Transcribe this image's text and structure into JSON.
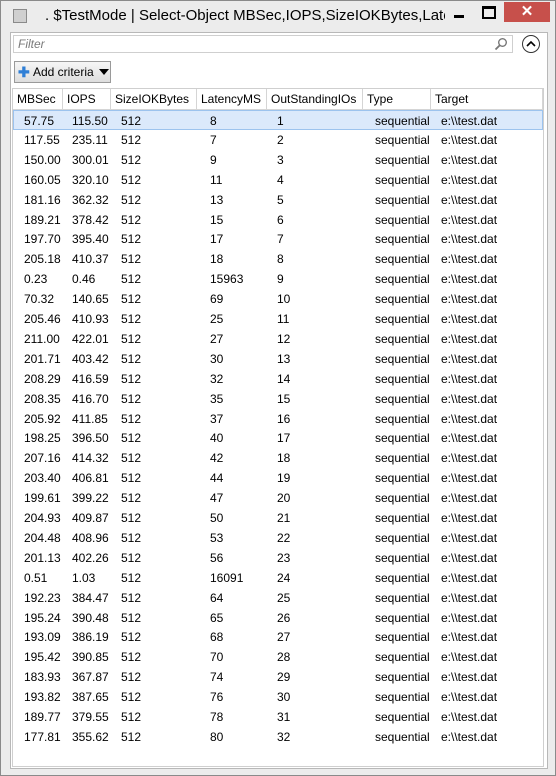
{
  "window": {
    "title": ". $TestMode | Select-Object MBSec,IOPS,SizeIOKBytes,Late...",
    "minimize_label": "",
    "maximize_label": "",
    "close_label": "✕"
  },
  "filter": {
    "placeholder": "Filter"
  },
  "toolbar": {
    "add_criteria_label": "Add criteria"
  },
  "grid": {
    "columns": [
      "MBSec",
      "IOPS",
      "SizeIOKBytes",
      "LatencyMS",
      "OutStandingIOs",
      "Type",
      "Target"
    ],
    "rows": [
      [
        "57.75",
        "115.50",
        "512",
        "8",
        "1",
        "sequential",
        "e:\\\\test.dat"
      ],
      [
        "117.55",
        "235.11",
        "512",
        "7",
        "2",
        "sequential",
        "e:\\\\test.dat"
      ],
      [
        "150.00",
        "300.01",
        "512",
        "9",
        "3",
        "sequential",
        "e:\\\\test.dat"
      ],
      [
        "160.05",
        "320.10",
        "512",
        "11",
        "4",
        "sequential",
        "e:\\\\test.dat"
      ],
      [
        "181.16",
        "362.32",
        "512",
        "13",
        "5",
        "sequential",
        "e:\\\\test.dat"
      ],
      [
        "189.21",
        "378.42",
        "512",
        "15",
        "6",
        "sequential",
        "e:\\\\test.dat"
      ],
      [
        "197.70",
        "395.40",
        "512",
        "17",
        "7",
        "sequential",
        "e:\\\\test.dat"
      ],
      [
        "205.18",
        "410.37",
        "512",
        "18",
        "8",
        "sequential",
        "e:\\\\test.dat"
      ],
      [
        "0.23",
        "0.46",
        "512",
        "15963",
        "9",
        "sequential",
        "e:\\\\test.dat"
      ],
      [
        "70.32",
        "140.65",
        "512",
        "69",
        "10",
        "sequential",
        "e:\\\\test.dat"
      ],
      [
        "205.46",
        "410.93",
        "512",
        "25",
        "11",
        "sequential",
        "e:\\\\test.dat"
      ],
      [
        "211.00",
        "422.01",
        "512",
        "27",
        "12",
        "sequential",
        "e:\\\\test.dat"
      ],
      [
        "201.71",
        "403.42",
        "512",
        "30",
        "13",
        "sequential",
        "e:\\\\test.dat"
      ],
      [
        "208.29",
        "416.59",
        "512",
        "32",
        "14",
        "sequential",
        "e:\\\\test.dat"
      ],
      [
        "208.35",
        "416.70",
        "512",
        "35",
        "15",
        "sequential",
        "e:\\\\test.dat"
      ],
      [
        "205.92",
        "411.85",
        "512",
        "37",
        "16",
        "sequential",
        "e:\\\\test.dat"
      ],
      [
        "198.25",
        "396.50",
        "512",
        "40",
        "17",
        "sequential",
        "e:\\\\test.dat"
      ],
      [
        "207.16",
        "414.32",
        "512",
        "42",
        "18",
        "sequential",
        "e:\\\\test.dat"
      ],
      [
        "203.40",
        "406.81",
        "512",
        "44",
        "19",
        "sequential",
        "e:\\\\test.dat"
      ],
      [
        "199.61",
        "399.22",
        "512",
        "47",
        "20",
        "sequential",
        "e:\\\\test.dat"
      ],
      [
        "204.93",
        "409.87",
        "512",
        "50",
        "21",
        "sequential",
        "e:\\\\test.dat"
      ],
      [
        "204.48",
        "408.96",
        "512",
        "53",
        "22",
        "sequential",
        "e:\\\\test.dat"
      ],
      [
        "201.13",
        "402.26",
        "512",
        "56",
        "23",
        "sequential",
        "e:\\\\test.dat"
      ],
      [
        "0.51",
        "1.03",
        "512",
        "16091",
        "24",
        "sequential",
        "e:\\\\test.dat"
      ],
      [
        "192.23",
        "384.47",
        "512",
        "64",
        "25",
        "sequential",
        "e:\\\\test.dat"
      ],
      [
        "195.24",
        "390.48",
        "512",
        "65",
        "26",
        "sequential",
        "e:\\\\test.dat"
      ],
      [
        "193.09",
        "386.19",
        "512",
        "68",
        "27",
        "sequential",
        "e:\\\\test.dat"
      ],
      [
        "195.42",
        "390.85",
        "512",
        "70",
        "28",
        "sequential",
        "e:\\\\test.dat"
      ],
      [
        "183.93",
        "367.87",
        "512",
        "74",
        "29",
        "sequential",
        "e:\\\\test.dat"
      ],
      [
        "193.82",
        "387.65",
        "512",
        "76",
        "30",
        "sequential",
        "e:\\\\test.dat"
      ],
      [
        "189.77",
        "379.55",
        "512",
        "78",
        "31",
        "sequential",
        "e:\\\\test.dat"
      ],
      [
        "177.81",
        "355.62",
        "512",
        "80",
        "32",
        "sequential",
        "e:\\\\test.dat"
      ]
    ],
    "selected_row": 0
  },
  "colors": {
    "accent": "#2f7fd6",
    "close_button": "#c7504b",
    "selection_background": "#dbe9fb",
    "selection_border": "#9cc3ee"
  },
  "icons": [
    "powershell-window-icon",
    "search-icon",
    "chevron-up-icon",
    "plus-icon",
    "caret-down-icon"
  ]
}
